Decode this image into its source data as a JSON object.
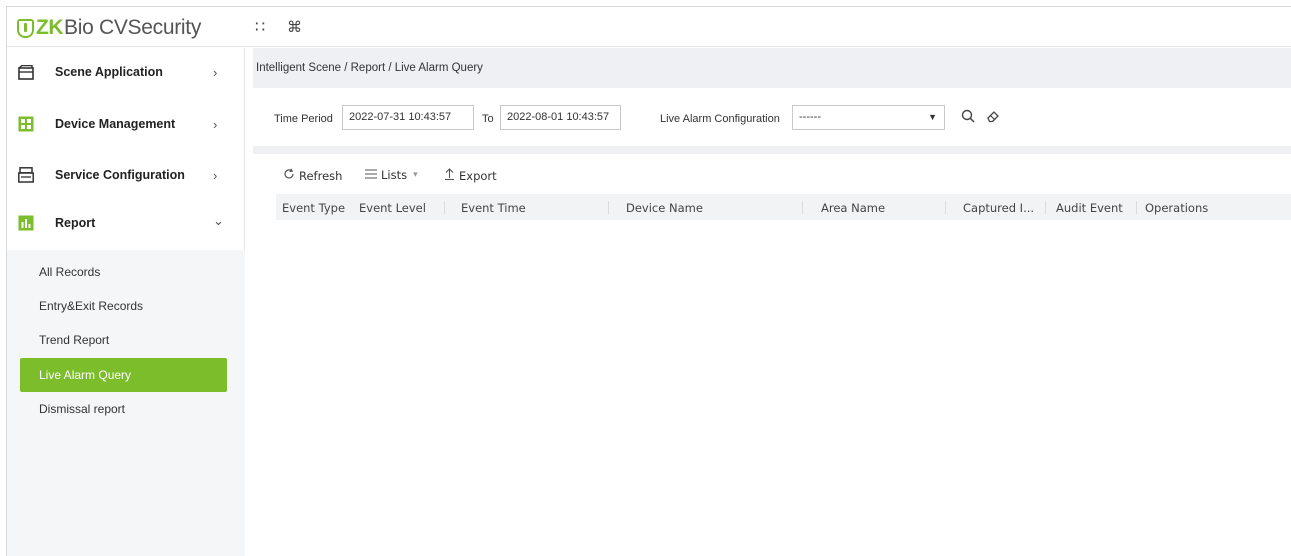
{
  "app": {
    "brand_zk": "ZK",
    "brand_rest": "Bio CVSecurity"
  },
  "topbar": {
    "apps_icon": "grid-icon",
    "cmd_icon": "command-icon",
    "apps_glyph": "∷",
    "cmd_glyph": "⌘"
  },
  "sidebar": {
    "items": [
      {
        "label": "Scene Application",
        "icon": "scene-icon",
        "arrow": "›"
      },
      {
        "label": "Device Management",
        "icon": "device-icon",
        "arrow": "›"
      },
      {
        "label": "Service Configuration",
        "icon": "service-icon",
        "arrow": "›"
      },
      {
        "label": "Report",
        "icon": "report-icon",
        "arrow": "⌄"
      }
    ],
    "subitems": [
      {
        "label": "All Records"
      },
      {
        "label": "Entry&Exit Records"
      },
      {
        "label": "Trend Report"
      },
      {
        "label": "Live Alarm Query",
        "active": true
      },
      {
        "label": "Dismissal report"
      }
    ]
  },
  "breadcrumb": "Intelligent Scene / Report / Live Alarm Query",
  "filters": {
    "time_period_label": "Time Period",
    "time_from": "2022-07-31 10:43:57",
    "to_label": "To",
    "time_to": "2022-08-01 10:43:57",
    "alarm_config_label": "Live Alarm Configuration",
    "alarm_config_value": "------"
  },
  "toolbar": {
    "refresh": "Refresh",
    "lists": "Lists",
    "export": "Export"
  },
  "table": {
    "columns": [
      "Event Type",
      "Event Level",
      "Event Time",
      "Device Name",
      "Area Name",
      "Captured I...",
      "Audit Event",
      "Operations"
    ]
  },
  "colors": {
    "accent": "#7cbd2c",
    "bar_bg": "#eef0f3"
  }
}
